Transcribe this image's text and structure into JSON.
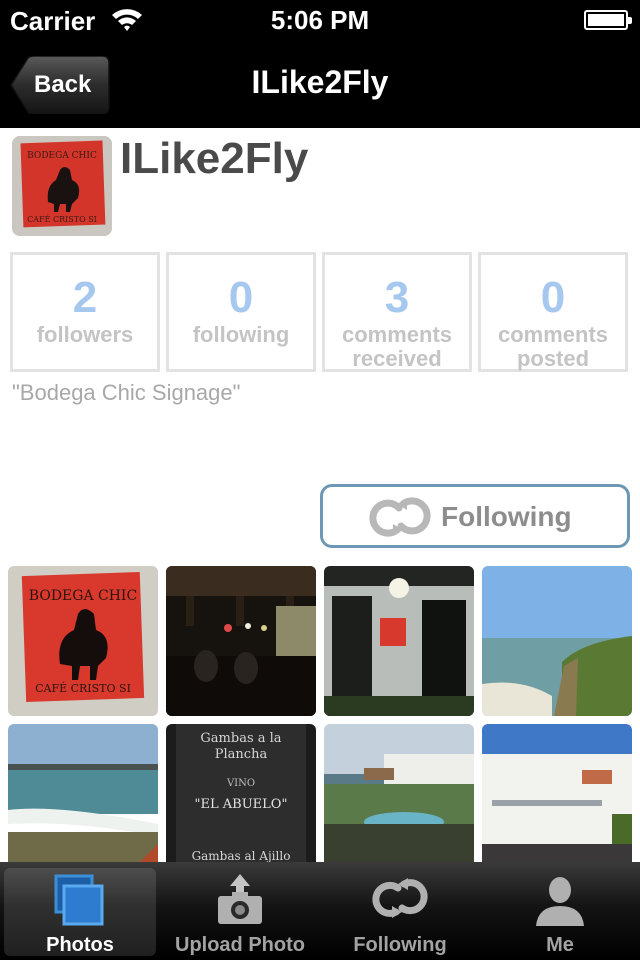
{
  "status_bar": {
    "carrier": "Carrier",
    "time": "5:06 PM"
  },
  "nav": {
    "back_label": "Back",
    "title": "ILike2Fly"
  },
  "profile": {
    "username": "ILike2Fly",
    "caption": "\"Bodega Chic Signage\"",
    "stats": [
      {
        "value": "2",
        "label_line1": "followers",
        "label_line2": ""
      },
      {
        "value": "0",
        "label_line1": "following",
        "label_line2": ""
      },
      {
        "value": "3",
        "label_line1": "comments",
        "label_line2": "received"
      },
      {
        "value": "0",
        "label_line1": "comments",
        "label_line2": "posted"
      }
    ],
    "follow_button_label": "Following",
    "avatar_sign_text": {
      "line1": "BODEGA CHIC",
      "line2": "CAFÉ CRISTO SI"
    }
  },
  "photos": {
    "sign_text": {
      "line1": "BODEGA CHIC",
      "line2": "CAFÉ CRISTO SI"
    },
    "menu_board_text": {
      "line1": "Gambas a la",
      "line2": "Plancha",
      "line3": "VINO",
      "line4": "\"EL ABUELO\"",
      "line5": "Gambas al Ajillo"
    }
  },
  "tab_bar": {
    "tabs": [
      {
        "label": "Photos",
        "icon": "photos-icon"
      },
      {
        "label": "Upload Photo",
        "icon": "camera-upload-icon"
      },
      {
        "label": "Following",
        "icon": "following-icon"
      },
      {
        "label": "Me",
        "icon": "person-icon"
      }
    ],
    "active_index": 0
  },
  "colors": {
    "stat_number": "#a6c7ee",
    "follow_border": "#6e97b3",
    "active_tab_icon": "#3b8fd8"
  }
}
